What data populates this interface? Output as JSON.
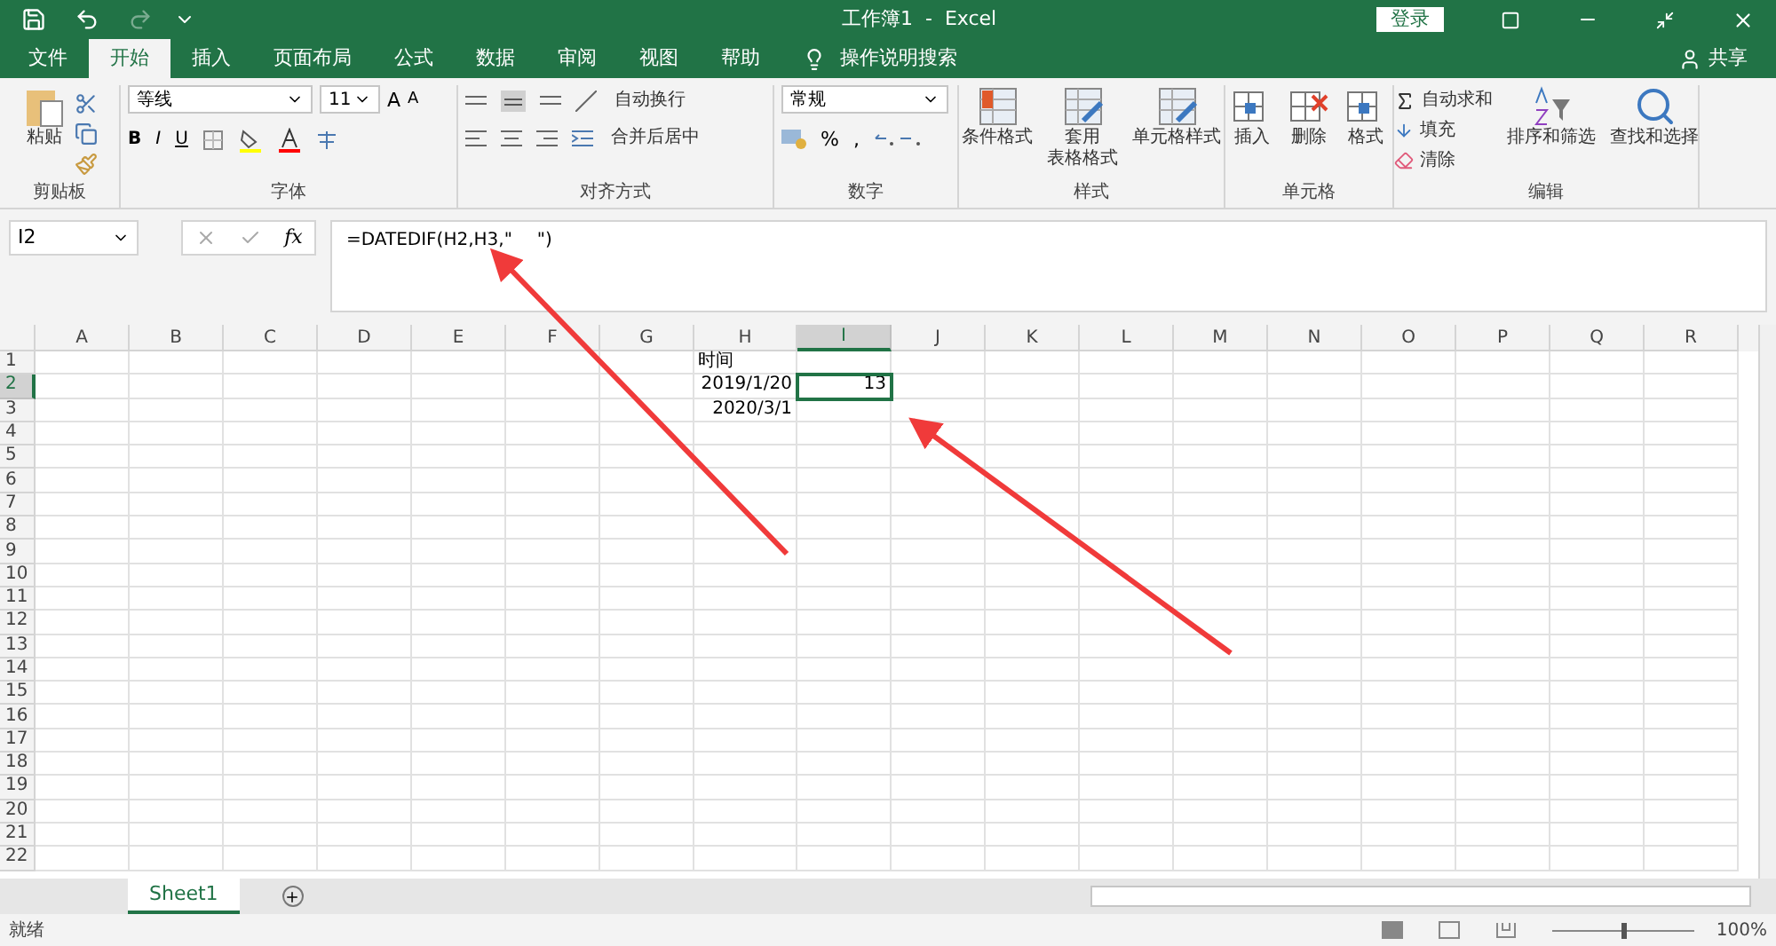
{
  "title_bar": {
    "title": "工作簿1  -  Excel",
    "login": "登录"
  },
  "menu_tabs": [
    {
      "label": "文件",
      "selected": false
    },
    {
      "label": "开始",
      "selected": true
    },
    {
      "label": "插入",
      "selected": false
    },
    {
      "label": "页面布局",
      "selected": false
    },
    {
      "label": "公式",
      "selected": false
    },
    {
      "label": "数据",
      "selected": false
    },
    {
      "label": "审阅",
      "selected": false
    },
    {
      "label": "视图",
      "selected": false
    },
    {
      "label": "帮助",
      "selected": false
    }
  ],
  "search_hint": "操作说明搜索",
  "share": "共享",
  "ribbon": {
    "clipboard": {
      "paste": "粘贴",
      "label": "剪贴板"
    },
    "font": {
      "name": "等线",
      "size": "11",
      "grow": "A",
      "shrink": "A",
      "bold": "B",
      "italic": "I",
      "underline": "U",
      "label": "字体"
    },
    "alignment": {
      "wrap": "自动换行",
      "merge": "合并后居中",
      "label": "对齐方式"
    },
    "number": {
      "format": "常规",
      "percent": "%",
      "comma": ",",
      "label": "数字"
    },
    "styles": {
      "items": [
        [
          "条件格式"
        ],
        [
          "套用",
          "表格格式"
        ],
        [
          "单元格样式"
        ]
      ],
      "label": "样式"
    },
    "cells": {
      "items": [
        "插入",
        "删除",
        "格式"
      ],
      "label": "单元格"
    },
    "editing": {
      "autosum": "自动求和",
      "fill": "填充",
      "clear": "清除",
      "sort": "排序和筛选",
      "find": "查找和选择",
      "label": "编辑"
    }
  },
  "formula_bar": {
    "name_box": "I2",
    "fx": "fx",
    "formula_start": "=DATEDIF(H2,H3,\"",
    "formula_end": "\")"
  },
  "columns": [
    {
      "label": "A",
      "selected": false
    },
    {
      "label": "B",
      "selected": false
    },
    {
      "label": "C",
      "selected": false
    },
    {
      "label": "D",
      "selected": false
    },
    {
      "label": "E",
      "selected": false
    },
    {
      "label": "F",
      "selected": false
    },
    {
      "label": "G",
      "selected": false
    },
    {
      "label": "H",
      "selected": false
    },
    {
      "label": "I",
      "selected": true
    },
    {
      "label": "J",
      "selected": false
    },
    {
      "label": "K",
      "selected": false
    },
    {
      "label": "L",
      "selected": false
    },
    {
      "label": "M",
      "selected": false
    },
    {
      "label": "N",
      "selected": false
    },
    {
      "label": "O",
      "selected": false
    },
    {
      "label": "P",
      "selected": false
    },
    {
      "label": "Q",
      "selected": false
    },
    {
      "label": "R",
      "selected": false
    }
  ],
  "rows": [
    {
      "label": "1",
      "selected": false,
      "cells": {
        "column_8": {
          "text": "时间",
          "kind": "text",
          "selected": false
        }
      }
    },
    {
      "label": "2",
      "selected": true,
      "cells": {
        "column_8": {
          "text": "2019/1/20",
          "kind": "number",
          "selected": false
        },
        "column_9": {
          "text": "13",
          "kind": "number",
          "selected": true
        }
      }
    },
    {
      "label": "3",
      "selected": false,
      "cells": {
        "column_8": {
          "text": "2020/3/1",
          "kind": "number",
          "selected": false
        }
      }
    },
    {
      "label": "4",
      "selected": false
    },
    {
      "label": "5",
      "selected": false
    },
    {
      "label": "6",
      "selected": false
    },
    {
      "label": "7",
      "selected": false
    },
    {
      "label": "8",
      "selected": false
    },
    {
      "label": "9",
      "selected": false
    },
    {
      "label": "10",
      "selected": false
    },
    {
      "label": "11",
      "selected": false
    },
    {
      "label": "12",
      "selected": false
    },
    {
      "label": "13",
      "selected": false
    },
    {
      "label": "14",
      "selected": false
    },
    {
      "label": "15",
      "selected": false
    },
    {
      "label": "16",
      "selected": false
    },
    {
      "label": "17",
      "selected": false
    },
    {
      "label": "18",
      "selected": false
    },
    {
      "label": "19",
      "selected": false
    },
    {
      "label": "20",
      "selected": false
    },
    {
      "label": "21",
      "selected": false
    },
    {
      "label": "22",
      "selected": false
    }
  ],
  "sheet_tabs": [
    {
      "label": "Sheet1",
      "selected": true
    }
  ],
  "status_bar": {
    "status": "就绪",
    "zoom": "100%",
    "zoom_slider": {
      "level": 0.5
    }
  }
}
